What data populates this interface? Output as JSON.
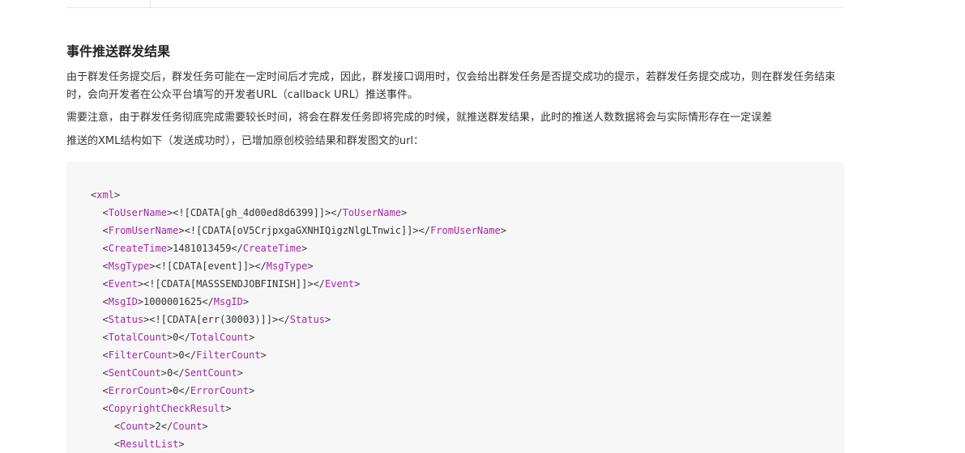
{
  "section": {
    "title": "事件推送群发结果",
    "paragraphs": [
      "由于群发任务提交后，群发任务可能在一定时间后才完成，因此，群发接口调用时，仅会给出群发任务是否提交成功的提示，若群发任务提交成功，则在群发任务结束时，会向开发者在公众平台填写的开发者URL（callback URL）推送事件。",
      "需要注意，由于群发任务彻底完成需要较长时间，将会在群发任务即将完成的时候，就推送群发结果，此时的推送人数数据将会与实际情形存在一定误差",
      "推送的XML结构如下（发送成功时），已增加原创校验结果和群发图文的url："
    ]
  },
  "code": {
    "lines": [
      {
        "indent": 0,
        "tag": "xml",
        "value": "",
        "close": false
      },
      {
        "indent": 1,
        "tag": "ToUserName",
        "value": "<![CDATA[gh_4d00ed8d6399]]>",
        "close": true
      },
      {
        "indent": 1,
        "tag": "FromUserName",
        "value": "<![CDATA[oV5CrjpxgaGXNHIQigzNlgLTnwic]]>",
        "close": true
      },
      {
        "indent": 1,
        "tag": "CreateTime",
        "value": "1481013459",
        "close": true
      },
      {
        "indent": 1,
        "tag": "MsgType",
        "value": "<![CDATA[event]]>",
        "close": true
      },
      {
        "indent": 1,
        "tag": "Event",
        "value": "<![CDATA[MASSSENDJOBFINISH]]>",
        "close": true
      },
      {
        "indent": 1,
        "tag": "MsgID",
        "value": "1000001625",
        "close": true
      },
      {
        "indent": 1,
        "tag": "Status",
        "value": "<![CDATA[err(30003)]]>",
        "close": true
      },
      {
        "indent": 1,
        "tag": "TotalCount",
        "value": "0",
        "close": true
      },
      {
        "indent": 1,
        "tag": "FilterCount",
        "value": "0",
        "close": true
      },
      {
        "indent": 1,
        "tag": "SentCount",
        "value": "0",
        "close": true
      },
      {
        "indent": 1,
        "tag": "ErrorCount",
        "value": "0",
        "close": true
      },
      {
        "indent": 1,
        "tag": "CopyrightCheckResult",
        "value": "",
        "close": false
      },
      {
        "indent": 2,
        "tag": "Count",
        "value": "2",
        "close": true
      },
      {
        "indent": 2,
        "tag": "ResultList",
        "value": "",
        "close": false
      }
    ]
  }
}
